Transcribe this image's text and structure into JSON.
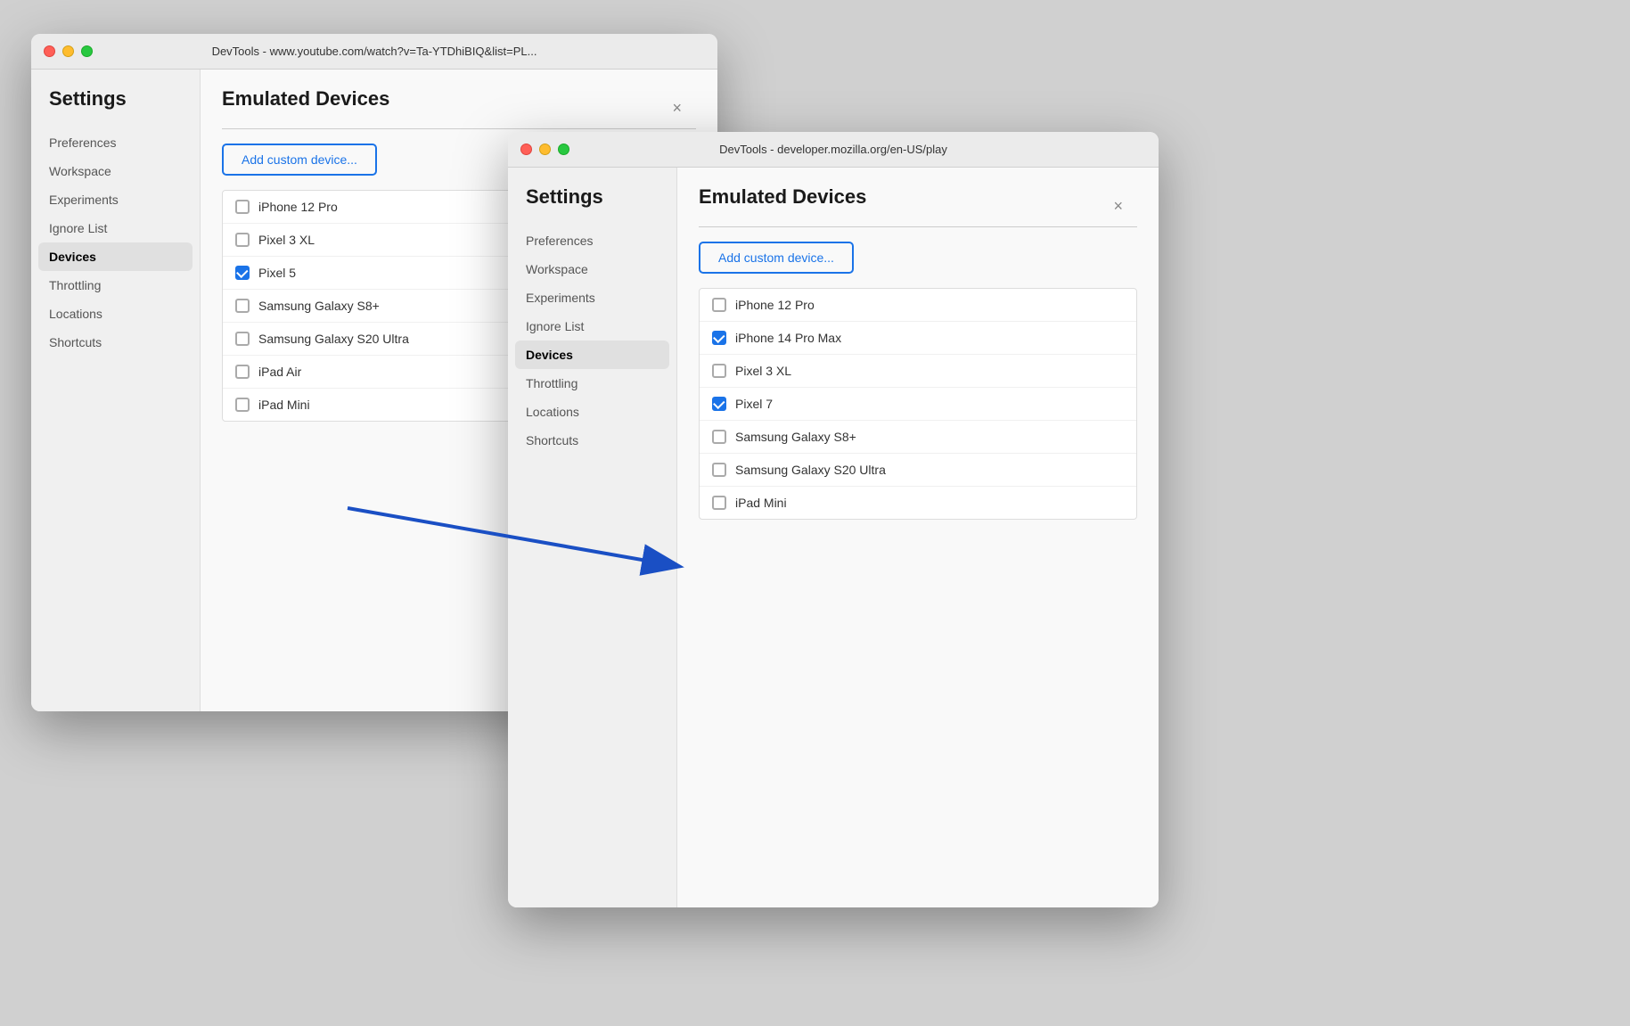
{
  "window1": {
    "titlebar": {
      "text": "DevTools - www.youtube.com/watch?v=Ta-YTDhiBIQ&list=PL..."
    },
    "sidebar": {
      "title": "Settings",
      "items": [
        {
          "label": "Preferences",
          "active": false
        },
        {
          "label": "Workspace",
          "active": false
        },
        {
          "label": "Experiments",
          "active": false
        },
        {
          "label": "Ignore List",
          "active": false
        },
        {
          "label": "Devices",
          "active": true
        },
        {
          "label": "Throttling",
          "active": false
        },
        {
          "label": "Locations",
          "active": false
        },
        {
          "label": "Shortcuts",
          "active": false
        }
      ]
    },
    "content": {
      "title": "Emulated Devices",
      "add_custom_label": "Add custom device...",
      "devices": [
        {
          "name": "iPhone 12 Pro",
          "checked": false
        },
        {
          "name": "Pixel 3 XL",
          "checked": false
        },
        {
          "name": "Pixel 5",
          "checked": true
        },
        {
          "name": "Samsung Galaxy S8+",
          "checked": false
        },
        {
          "name": "Samsung Galaxy S20 Ultra",
          "checked": false
        },
        {
          "name": "iPad Air",
          "checked": false
        },
        {
          "name": "iPad Mini",
          "checked": false
        }
      ]
    }
  },
  "window2": {
    "titlebar": {
      "text": "DevTools - developer.mozilla.org/en-US/play"
    },
    "sidebar": {
      "title": "Settings",
      "items": [
        {
          "label": "Preferences",
          "active": false
        },
        {
          "label": "Workspace",
          "active": false
        },
        {
          "label": "Experiments",
          "active": false
        },
        {
          "label": "Ignore List",
          "active": false
        },
        {
          "label": "Devices",
          "active": true
        },
        {
          "label": "Throttling",
          "active": false
        },
        {
          "label": "Locations",
          "active": false
        },
        {
          "label": "Shortcuts",
          "active": false
        }
      ]
    },
    "content": {
      "title": "Emulated Devices",
      "add_custom_label": "Add custom device...",
      "devices": [
        {
          "name": "iPhone 12 Pro",
          "checked": false
        },
        {
          "name": "iPhone 14 Pro Max",
          "checked": true
        },
        {
          "name": "Pixel 3 XL",
          "checked": false
        },
        {
          "name": "Pixel 7",
          "checked": true
        },
        {
          "name": "Samsung Galaxy S8+",
          "checked": false
        },
        {
          "name": "Samsung Galaxy S20 Ultra",
          "checked": false
        },
        {
          "name": "iPad Mini",
          "checked": false
        }
      ]
    }
  },
  "arrow": {
    "label": "Devices arrow annotation"
  }
}
